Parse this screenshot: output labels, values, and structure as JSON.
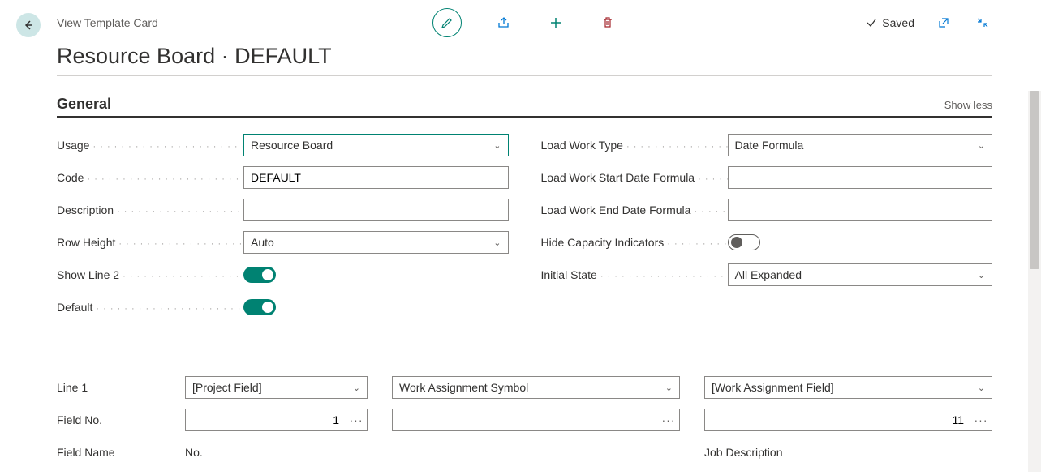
{
  "header": {
    "subtitle": "View Template Card",
    "saved_label": "Saved"
  },
  "title": "Resource Board · DEFAULT",
  "section_general": {
    "title": "General",
    "show_less": "Show less"
  },
  "fields": {
    "usage": {
      "label": "Usage",
      "value": "Resource Board"
    },
    "code": {
      "label": "Code",
      "value": "DEFAULT"
    },
    "description": {
      "label": "Description",
      "value": ""
    },
    "row_height": {
      "label": "Row Height",
      "value": "Auto"
    },
    "show_line_2": {
      "label": "Show Line 2",
      "value": true
    },
    "default": {
      "label": "Default",
      "value": true
    },
    "load_work_type": {
      "label": "Load Work Type",
      "value": "Date Formula"
    },
    "load_work_start": {
      "label": "Load Work Start Date Formula",
      "value": ""
    },
    "load_work_end": {
      "label": "Load Work End Date Formula",
      "value": ""
    },
    "hide_capacity": {
      "label": "Hide Capacity Indicators",
      "value": false
    },
    "initial_state": {
      "label": "Initial State",
      "value": "All Expanded"
    }
  },
  "lower_labels": {
    "line1": "Line 1",
    "field_no": "Field No.",
    "field_name": "Field Name"
  },
  "columns": [
    {
      "line1_value": "[Project Field]",
      "field_no": "1",
      "field_name": "No."
    },
    {
      "line1_value": "Work Assignment Symbol",
      "field_no": "",
      "field_name": ""
    },
    {
      "line1_value": "[Work Assignment Field]",
      "field_no": "11",
      "field_name": "Job Description"
    }
  ]
}
